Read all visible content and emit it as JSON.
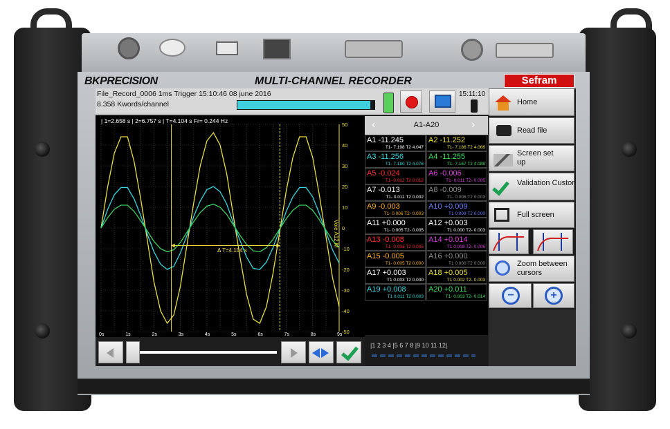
{
  "device": {
    "brand_logo": "BKPRECISION",
    "model_title": "MULTI-CHANNEL RECORDER",
    "partner_logo": "Sefram"
  },
  "header": {
    "file_info": "File_Record_0006  1ms  Trigger 15:10:46 08 june 2016",
    "memory_info": "8.358 Kwords/channel",
    "clock": "15:11:10",
    "progress_fraction": 0.97
  },
  "plot": {
    "measure_bar": "| 1=2.658 s | 2=6.757 s | T=4.104 s Fr= 0.244 Hz",
    "delta_label": "Δ T=4.104 s",
    "right_axis_label": "Voie A12 M",
    "y_ticks": [
      "50",
      "40",
      "30",
      "20",
      "10",
      "0",
      "-10",
      "-20",
      "-30",
      "-40",
      "-50"
    ],
    "x_ticks": [
      "0s",
      "1s",
      "2s",
      "3s",
      "4s",
      "5s",
      "6s",
      "7s",
      "8s",
      "9s"
    ]
  },
  "chart_data": {
    "type": "line",
    "x": [
      0,
      0.25,
      0.5,
      0.75,
      1,
      1.25,
      1.5,
      1.75,
      2,
      2.25,
      2.5,
      2.75,
      3,
      3.25,
      3.5,
      3.75,
      4,
      4.25,
      4.5,
      4.75,
      5,
      5.25,
      5.5,
      5.75,
      6,
      6.25,
      6.5,
      6.75,
      7,
      7.25,
      7.5,
      7.75,
      8,
      8.25,
      8.5,
      8.75,
      9
    ],
    "series": [
      {
        "values": [
          0,
          20,
          36,
          44,
          44,
          32,
          14,
          -6,
          -26,
          -40,
          -46,
          -42,
          -28,
          -8,
          12,
          30,
          42,
          46,
          40,
          26,
          6,
          -14,
          -32,
          -44,
          -46,
          -38,
          -22,
          -2,
          18,
          34,
          44,
          44,
          34,
          16,
          -4,
          -24,
          -38
        ],
        "color": "#e8e040"
      },
      {
        "values": [
          0,
          9,
          16,
          19.5,
          19.5,
          14,
          6,
          -3,
          -11.5,
          -17.5,
          -20,
          -18.5,
          -12,
          -3.5,
          5.5,
          13,
          18.5,
          20,
          17.5,
          11.5,
          2.5,
          -6,
          -14,
          -19.5,
          -20,
          -16.5,
          -9.5,
          -1,
          8,
          15,
          19.5,
          19.5,
          15,
          7,
          -2,
          -10.5,
          -17
        ],
        "color": "#38d8e0"
      },
      {
        "values": [
          0,
          5,
          9,
          11,
          11,
          8,
          3.5,
          -1.5,
          -6.5,
          -10,
          -11.5,
          -10.5,
          -7,
          -2,
          3,
          7.5,
          10.5,
          11.5,
          10,
          6.5,
          1.5,
          -3.5,
          -8,
          -11,
          -11.5,
          -9.5,
          -5.5,
          -0.5,
          4.5,
          8.5,
          11,
          11,
          8.5,
          4,
          -1,
          -6,
          -9.5
        ],
        "color": "#40d060"
      }
    ],
    "cursors_x": [
      2.658,
      6.757
    ],
    "xlim": [
      0,
      9
    ],
    "ylim": [
      -50,
      50
    ],
    "grid": true
  },
  "channels": {
    "tab_label": "A1-A20",
    "items": [
      {
        "name": "A1",
        "value": "-11.245",
        "sub": "T1- 7.198 T2  4.047",
        "color": "#ffffff",
        "subcolor": "#ffffff"
      },
      {
        "name": "A2",
        "value": "-11.252",
        "sub": "T1- 7.186 T2  4.066",
        "color": "#f0e040",
        "subcolor": "#f0e040"
      },
      {
        "name": "A3",
        "value": "-11.256",
        "sub": "T1- 7.180 T2  4.076",
        "color": "#38d8e0",
        "subcolor": "#38d8e0"
      },
      {
        "name": "A4",
        "value": "-11.255",
        "sub": "T1- 7.167 T2  4.088",
        "color": "#40e060",
        "subcolor": "#40e060"
      },
      {
        "name": "A5",
        "value": "-0.024",
        "sub": "T1- 0.012 T2  0.012",
        "color": "#ff3030",
        "subcolor": "#ff3030"
      },
      {
        "name": "A6",
        "value": "-0.006",
        "sub": "T1- 0.011 T2- 0.005",
        "color": "#e040e0",
        "subcolor": "#e040e0"
      },
      {
        "name": "A7",
        "value": "-0.013",
        "sub": "T1- 0.011 T2  0.002",
        "color": "#ffffff",
        "subcolor": "#ffffff"
      },
      {
        "name": "A8",
        "value": "-0.009",
        "sub": "T1- 0.006 T2  0.003",
        "color": "#909090",
        "subcolor": "#909090"
      },
      {
        "name": "A9",
        "value": "-0.003",
        "sub": "T1- 0.006 T2- 0.003",
        "color": "#ffb020",
        "subcolor": "#ffb020"
      },
      {
        "name": "A10",
        "value": "+0.009",
        "sub": "T1  0.009 T2  0.000",
        "color": "#6a80ff",
        "subcolor": "#6a80ff"
      },
      {
        "name": "A11",
        "value": "+0.000",
        "sub": "T1- 0.005 T2- 0.005",
        "color": "#ffffff",
        "subcolor": "#ffffff"
      },
      {
        "name": "A12",
        "value": "+0.003",
        "sub": "T1  0.000 T2- 0.003",
        "color": "#ffffff",
        "subcolor": "#ffffff"
      },
      {
        "name": "A13",
        "value": "-0.008",
        "sub": "T1- 0.003 T2  0.005",
        "color": "#ff3030",
        "subcolor": "#ff3030"
      },
      {
        "name": "A14",
        "value": "+0.014",
        "sub": "T1  0.008 T2- 0.006",
        "color": "#e040e0",
        "subcolor": "#e040e0"
      },
      {
        "name": "A15",
        "value": "-0.005",
        "sub": "T1- 0.005 T2  0.000",
        "color": "#ffb020",
        "subcolor": "#ffb020"
      },
      {
        "name": "A16",
        "value": "+0.000",
        "sub": "T1  0.000 T2  0.000",
        "color": "#909090",
        "subcolor": "#909090"
      },
      {
        "name": "A17",
        "value": "+0.003",
        "sub": "T1  0.003 T2  0.000",
        "color": "#ffffff",
        "subcolor": "#ffffff"
      },
      {
        "name": "A18",
        "value": "+0.005",
        "sub": "T1  0.002 T2- 0.003",
        "color": "#f0e040",
        "subcolor": "#f0e040"
      },
      {
        "name": "A19",
        "value": "+0.008",
        "sub": "T1  0.011 T2  0.003",
        "color": "#38d8e0",
        "subcolor": "#38d8e0"
      },
      {
        "name": "A20",
        "value": "+0.011",
        "sub": "T1- 0.003 T2- 0.014",
        "color": "#40e060",
        "subcolor": "#40e060"
      }
    ]
  },
  "page_strip": {
    "label": "|1  2  3  4 |5  6  7  8 |9  10  11  12|"
  },
  "sidebar": {
    "home": "Home",
    "read_file": "Read file",
    "screen_setup": "Screen set up",
    "validation": "Validation Custom pages",
    "full_screen": "Full screen",
    "zoom_between": "Zoom between cursors"
  }
}
